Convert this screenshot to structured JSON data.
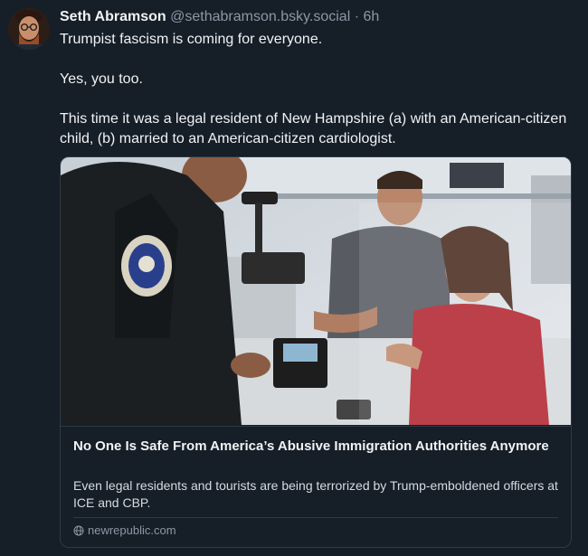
{
  "post": {
    "author_name": "Seth Abramson",
    "handle": "@sethabramson.bsky.social",
    "separator": "·",
    "time": "6h",
    "paragraphs": [
      "Trumpist fascism is coming for everyone.",
      "Yes, you too.",
      "This time it was a legal resident of New Hampshire (a) with an American-citizen child, (b) married to an American-citizen cardiologist."
    ]
  },
  "link_card": {
    "title": "No One Is Safe From America’s Abusive Immigration Authorities Anymore",
    "description": "Even legal residents and tourists are being terrorized by Trump-emboldened officers at ICE and CBP.",
    "domain": "newrepublic.com",
    "domain_icon": "globe-icon"
  },
  "colors": {
    "background": "#161e27",
    "card_border": "#2e3a47",
    "muted_text": "#8b98a5"
  }
}
